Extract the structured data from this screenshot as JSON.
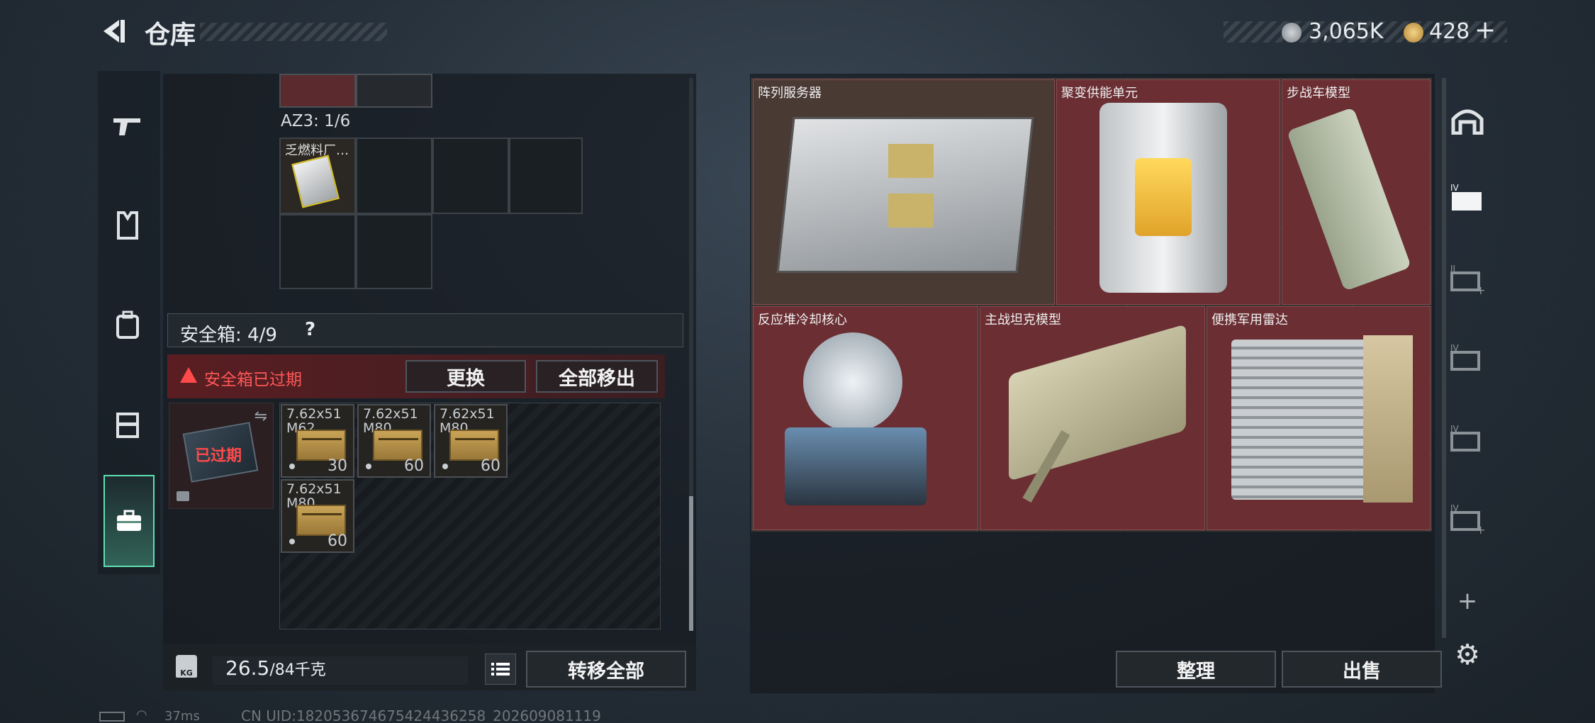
{
  "header": {
    "title": "仓库",
    "currency1": "3,065K",
    "currency2": "428",
    "plus": "+"
  },
  "icons": {
    "back": "back-arrow-icon",
    "currency1": "silver-coin-icon",
    "currency2": "gold-coin-icon"
  },
  "left_nav": [
    "gun-icon",
    "armor-vest-icon",
    "backpack-icon",
    "chest-rig-icon",
    "safe-box-icon"
  ],
  "stash": {
    "az3_label": "AZ3: 1/6",
    "item_label": "乏燃料厂…",
    "safebox_label": "安全箱: 4/9",
    "help": "?",
    "expired_warning": "安全箱已过期",
    "replace_button": "更换",
    "move_all_out_button": "全部移出",
    "safebox_expired_badge": "已过期",
    "ammo": [
      {
        "name": "7.62x51\nM62",
        "count": "30"
      },
      {
        "name": "7.62x51\nM80",
        "count": "60"
      },
      {
        "name": "7.62x51\nM80",
        "count": "60"
      },
      {
        "name": "7.62x51\nM80",
        "count": "60"
      }
    ]
  },
  "footer_left": {
    "weight_value": "26.5",
    "weight_max": "/84千克",
    "transfer_all": "转移全部"
  },
  "right_panel": {
    "items": [
      {
        "label": "阵列服务器"
      },
      {
        "label": "聚变供能单元"
      },
      {
        "label": "步战车模型"
      },
      {
        "label": "反应堆冷却核心"
      },
      {
        "label": "主战坦克模型"
      },
      {
        "label": "便携军用雷达"
      }
    ],
    "sort_button": "整理",
    "sell_button": "出售",
    "add": "+"
  },
  "right_tabs": [
    "bunker-icon",
    "container-iv-icon",
    "container-add-ii-icon",
    "container-iv-icon",
    "container-iv-icon",
    "container-add-iv-icon"
  ],
  "status_bar": {
    "ping": "37ms",
    "uid": "CN UID:18205367467542443625​8_202609081119"
  },
  "colors": {
    "accent": "#5fe0b3",
    "item_bg": "#6a2e33",
    "warning": "#e23b3b"
  }
}
